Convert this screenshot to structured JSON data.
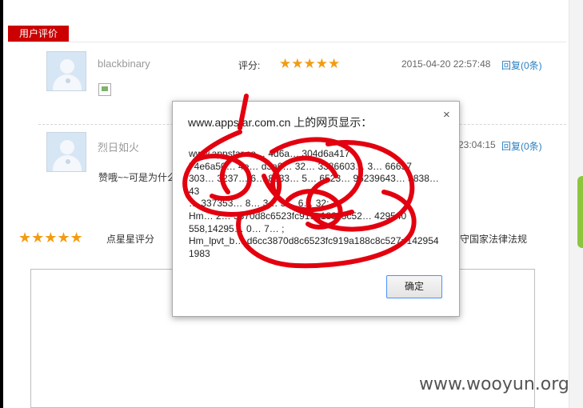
{
  "section": {
    "tab_label": "用户评价"
  },
  "reviews": [
    {
      "username": "blackbinary",
      "rating_label": "评分:",
      "stars": "★★★★★",
      "datetime": "2015-04-20 22:57:48",
      "reply": "回复(0条)"
    },
    {
      "username": "烈日如火",
      "comment_visible": "赞哦~~可是为什么",
      "datetime_partial": "23:04:15",
      "reply": "回复(0条)"
    }
  ],
  "rate_widget": {
    "stars": "★★★★★",
    "label": "点星星评分"
  },
  "notice_partial": "守国家法律法规",
  "dialog": {
    "title": "www.appstar.com.cn 上的网页显示：",
    "close": "×",
    "message": "www.appstar.co… 4d6a… 304d6a417\n74e6a50… 4e… d3a6… 32… 3386603… 3… 66637\n303… 3237… 6… 8333… 5… 6523… 96239643… 3838… 43\n… 337353… 8… 3… 3… 6… 32;\nHm… 2… 3870d8c6523fc919a188c8c52… 429540\n558,14295… 0… 7… ;\nHm_lpvt_b… d6cc3870d8c6523fc919a188c8c527=142954\n1983",
    "ok_label": "确定"
  },
  "watermark": "www.wooyun.org",
  "colors": {
    "accent_red": "#cc0000",
    "star": "#f39c12",
    "link": "#2a7fc1",
    "scribble": "#e3000f"
  }
}
